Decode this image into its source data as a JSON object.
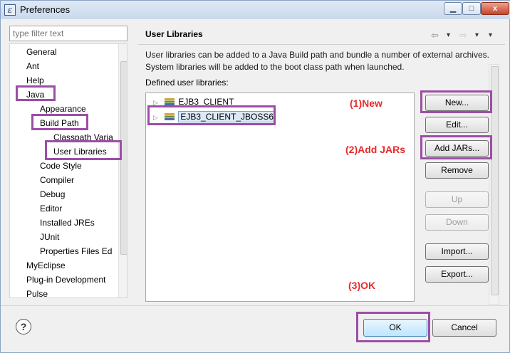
{
  "window": {
    "title": "Preferences",
    "icon": "eclipse-icon",
    "min_label": "▁",
    "max_label": "□",
    "close_label": "x"
  },
  "filter": {
    "placeholder": "type filter text"
  },
  "tree": {
    "items": [
      {
        "label": "General"
      },
      {
        "label": "Ant"
      },
      {
        "label": "Help"
      },
      {
        "label": "Java"
      },
      {
        "label": "Appearance"
      },
      {
        "label": "Build Path"
      },
      {
        "label": "Classpath Varia"
      },
      {
        "label": "User Libraries"
      },
      {
        "label": "Code Style"
      },
      {
        "label": "Compiler"
      },
      {
        "label": "Debug"
      },
      {
        "label": "Editor"
      },
      {
        "label": "Installed JREs"
      },
      {
        "label": "JUnit"
      },
      {
        "label": "Properties Files Ed"
      },
      {
        "label": "MyEclipse"
      },
      {
        "label": "Plug-in Development"
      },
      {
        "label": "Pulse"
      }
    ]
  },
  "page": {
    "title": "User Libraries",
    "description": "User libraries can be added to a Java Build path and bundle a number of external archives. System libraries will be added to the boot class path when launched.",
    "defined_label": "Defined user libraries:",
    "libraries": [
      {
        "name": "EJB3_CLIENT"
      },
      {
        "name": "EJB3_CLIENT_JBOSS6"
      }
    ],
    "nav": {
      "back": "⇦",
      "forward": "⇨",
      "menu": "▾"
    }
  },
  "buttons": {
    "new": "New...",
    "edit": "Edit...",
    "add_jars": "Add JARs...",
    "remove": "Remove",
    "up": "Up",
    "down": "Down",
    "import": "Import...",
    "export": "Export..."
  },
  "annotations": {
    "step1": "(1)New",
    "step2": "(2)Add JARs",
    "step3": "(3)OK"
  },
  "dialog": {
    "help": "?",
    "ok": "OK",
    "cancel": "Cancel"
  },
  "colors": {
    "highlight": "#9c4ea6",
    "annotation": "#e8292b"
  }
}
